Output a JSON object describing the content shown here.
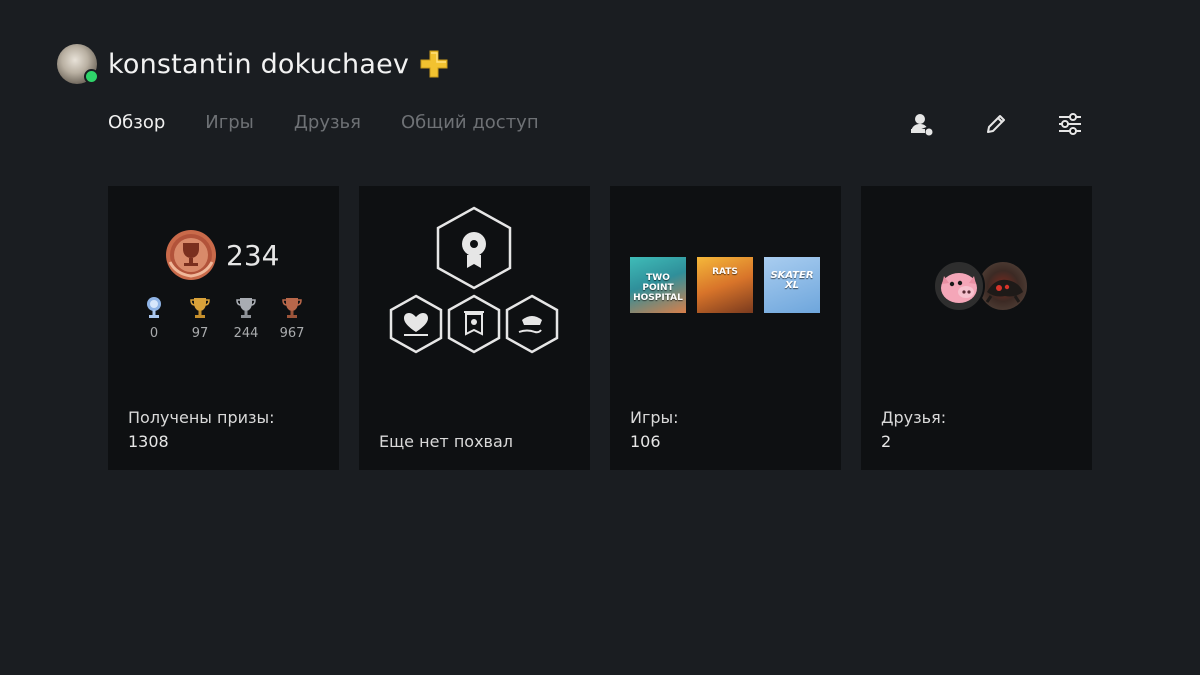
{
  "profile": {
    "username": "konstantin dokuchaev",
    "online_status_color": "#2fd46a",
    "plus_icon": "ps-plus-icon",
    "plus_color": "#f2c230"
  },
  "tabs": [
    {
      "label": "Обзор",
      "active": true
    },
    {
      "label": "Игры",
      "active": false
    },
    {
      "label": "Друзья",
      "active": false
    },
    {
      "label": "Общий доступ",
      "active": false
    }
  ],
  "actions": [
    {
      "icon": "friend-request-icon"
    },
    {
      "icon": "edit-pencil-icon"
    },
    {
      "icon": "settings-sliders-icon"
    }
  ],
  "cards": {
    "trophies": {
      "level": "234",
      "counts": {
        "platinum": "0",
        "gold": "97",
        "silver": "244",
        "bronze": "967"
      },
      "caption_label": "Получены призы:",
      "caption_value": "1308"
    },
    "praise": {
      "caption_label": "Еще нет похвал"
    },
    "games": {
      "thumbs": [
        {
          "label": "TWO POINT HOSPITAL"
        },
        {
          "label": "RATS"
        },
        {
          "label": "SKATER XL"
        }
      ],
      "caption_label": "Игры:",
      "caption_value": "106"
    },
    "friends": {
      "caption_label": "Друзья:",
      "caption_value": "2"
    }
  }
}
